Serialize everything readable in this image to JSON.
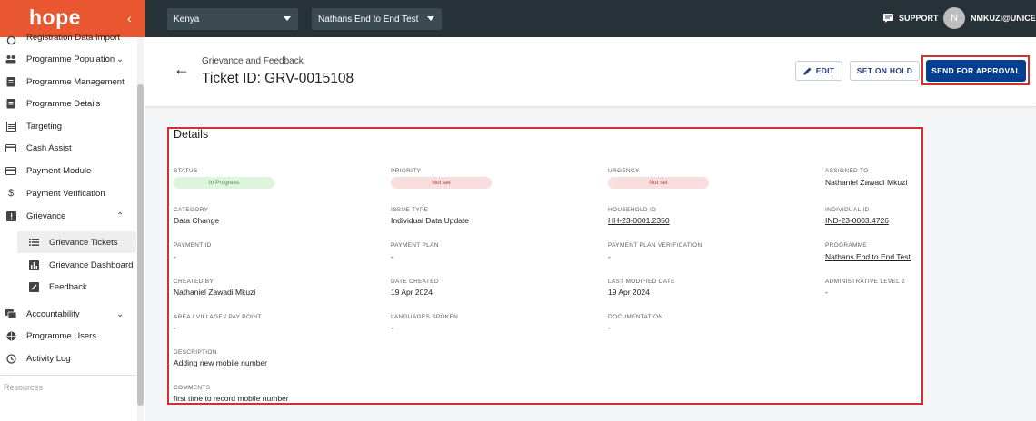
{
  "sidebar": {
    "logo": "hope",
    "collapse_icon": "chevron-left-icon",
    "items": [
      {
        "label": "Registration Data Import",
        "icon": "import-icon"
      },
      {
        "label": "Programme Population",
        "icon": "people-icon",
        "expandable": true
      },
      {
        "label": "Programme Management",
        "icon": "clipboard-icon"
      },
      {
        "label": "Programme Details",
        "icon": "clipboard-icon"
      },
      {
        "label": "Targeting",
        "icon": "list-icon"
      },
      {
        "label": "Cash Assist",
        "icon": "card-icon"
      },
      {
        "label": "Payment Module",
        "icon": "card-icon"
      },
      {
        "label": "Payment Verification",
        "icon": "dollar-icon"
      },
      {
        "label": "Grievance",
        "icon": "alert-icon",
        "expanded": true
      }
    ],
    "sub_items": [
      {
        "label": "Grievance Tickets",
        "icon": "list-icon",
        "active": true
      },
      {
        "label": "Grievance Dashboard",
        "icon": "chart-icon"
      },
      {
        "label": "Feedback",
        "icon": "feedback-icon"
      }
    ],
    "lower_items": [
      {
        "label": "Accountability",
        "icon": "chat-icon",
        "expandable": true
      },
      {
        "label": "Programme Users",
        "icon": "globe-icon"
      },
      {
        "label": "Activity Log",
        "icon": "history-icon"
      }
    ],
    "resources_label": "Resources"
  },
  "topbar": {
    "country": "Kenya",
    "programme": "Nathans End to End Test",
    "support_label": "SUPPORT",
    "avatar_initial": "N",
    "user_label": "NMKUZI@UNICE"
  },
  "header": {
    "breadcrumb": "Grievance and Feedback",
    "title": "Ticket ID: GRV-0015108",
    "edit_label": "EDIT",
    "hold_label": "SET ON HOLD",
    "approve_label": "SEND FOR APPROVAL"
  },
  "details": {
    "title": "Details",
    "status": {
      "label": "STATUS",
      "value": "In Progress"
    },
    "priority": {
      "label": "PRIORITY",
      "value": "Not set"
    },
    "urgency": {
      "label": "URGENCY",
      "value": "Not set"
    },
    "assigned": {
      "label": "ASSIGNED TO",
      "value": "Nathaniel Zawadi Mkuzi"
    },
    "category": {
      "label": "CATEGORY",
      "value": "Data Change"
    },
    "issue_type": {
      "label": "ISSUE TYPE",
      "value": "Individual Data Update"
    },
    "household": {
      "label": "HOUSEHOLD ID",
      "value": "HH-23-0001.2350"
    },
    "individual": {
      "label": "INDIVIDUAL ID",
      "value": "IND-23-0003.4726"
    },
    "payment_id": {
      "label": "PAYMENT ID",
      "value": "-"
    },
    "payment_plan": {
      "label": "PAYMENT PLAN",
      "value": "-"
    },
    "plan_verification": {
      "label": "PAYMENT PLAN VERIFICATION",
      "value": "-"
    },
    "programme": {
      "label": "PROGRAMME",
      "value": "Nathans End to End Test"
    },
    "created_by": {
      "label": "CREATED BY",
      "value": "Nathaniel Zawadi Mkuzi"
    },
    "date_created": {
      "label": "DATE CREATED",
      "value": "19 Apr 2024"
    },
    "last_modified": {
      "label": "LAST MODIFIED DATE",
      "value": "19 Apr 2024"
    },
    "admin_level": {
      "label": "ADMINISTRATIVE LEVEL 2",
      "value": "-"
    },
    "area": {
      "label": "AREA / VILLAGE / PAY POINT",
      "value": "-"
    },
    "languages": {
      "label": "LANGUAGES SPOKEN",
      "value": "-"
    },
    "documentation": {
      "label": "DOCUMENTATION",
      "value": "-"
    },
    "description": {
      "label": "DESCRIPTION",
      "value": "Adding new mobile number"
    },
    "comments": {
      "label": "COMMENTS",
      "value": "first time to record mobile number"
    }
  },
  "colors": {
    "brand": "#e8572f",
    "topbar": "#263238",
    "primary": "#033f91",
    "highlight": "#d32f2f",
    "chip_green": "#dcf5dc",
    "chip_red": "#f8dede"
  }
}
